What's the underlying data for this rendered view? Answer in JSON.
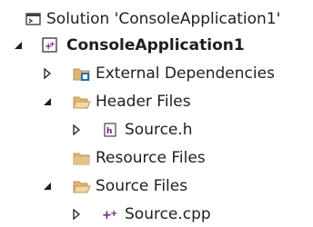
{
  "tree": {
    "solution": {
      "label": "Solution 'ConsoleApplication1'",
      "icon": "solution-icon"
    },
    "project": {
      "label": "ConsoleApplication1",
      "icon": "cpp-project-icon",
      "expanded": true
    },
    "nodes": [
      {
        "label": "External Dependencies",
        "icon": "filter-folder-icon",
        "expanded": false
      },
      {
        "label": "Header Files",
        "icon": "filter-folder-icon",
        "expanded": true
      },
      {
        "label": "Source.h",
        "icon": "header-file-icon",
        "expanded": false
      },
      {
        "label": "Resource Files",
        "icon": "filter-folder-icon"
      },
      {
        "label": "Source Files",
        "icon": "filter-folder-icon",
        "expanded": true
      },
      {
        "label": "Source.cpp",
        "icon": "cpp-file-icon",
        "expanded": false
      }
    ]
  },
  "colors": {
    "folder": "#dcb67a",
    "folder_dark": "#c09552",
    "filter_blue": "#1f6fb5",
    "cpp_purple": "#68217a",
    "expander_dark": "#1e1e1e"
  }
}
